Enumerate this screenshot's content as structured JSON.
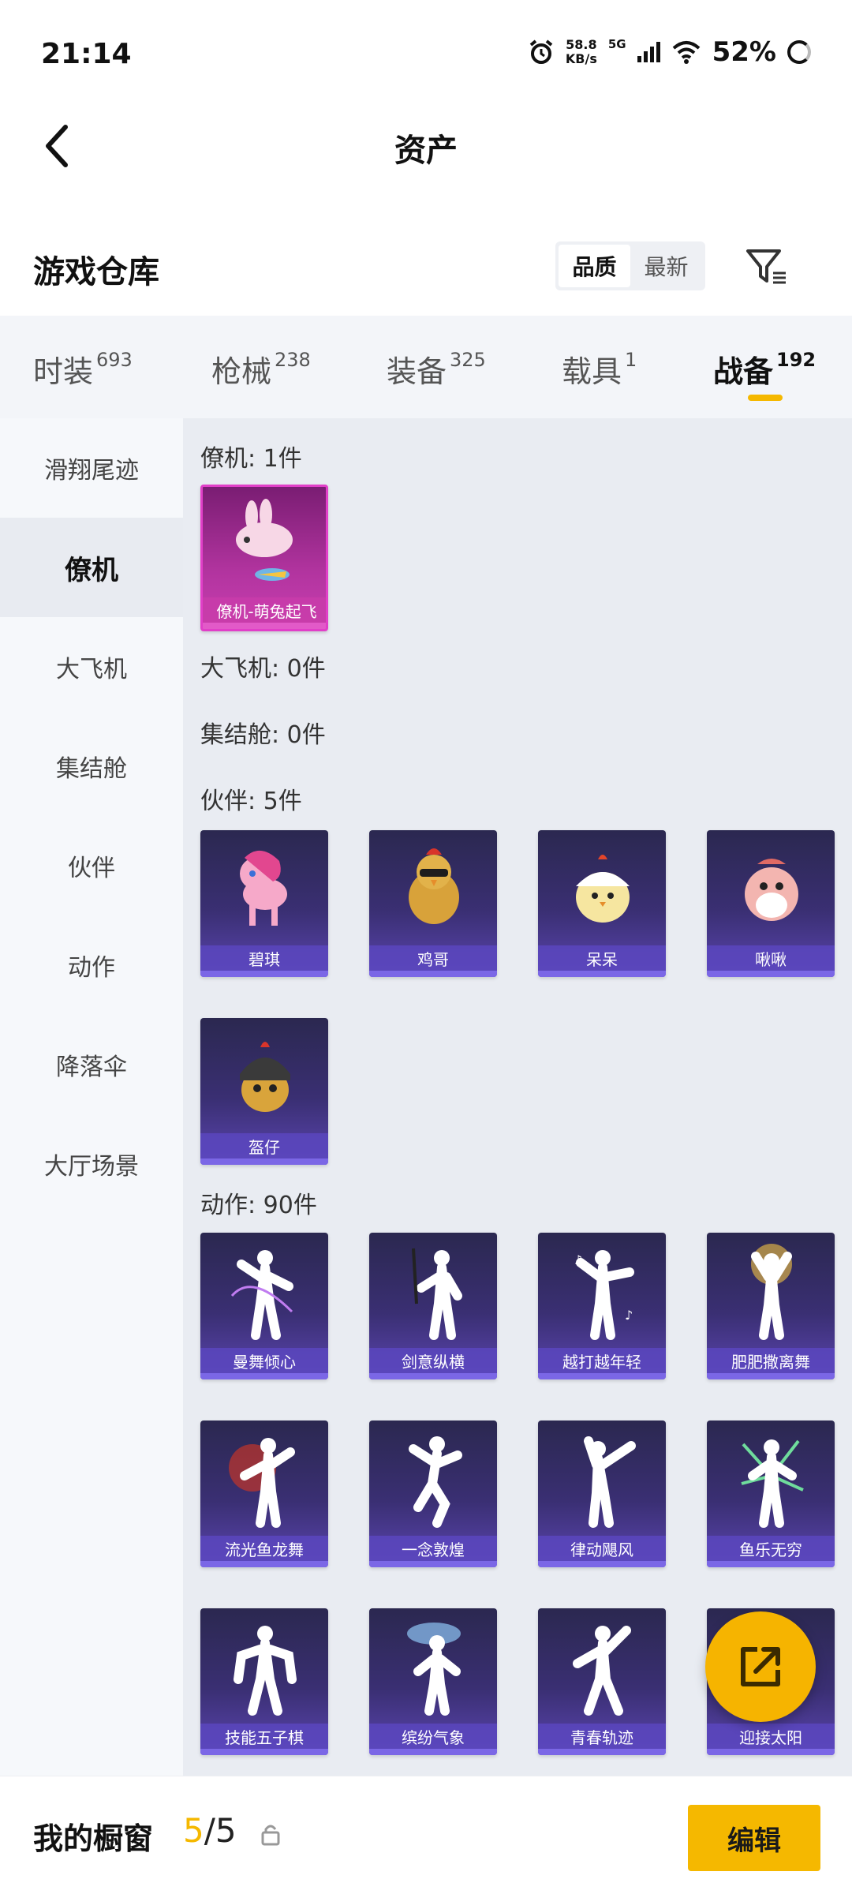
{
  "status_bar": {
    "time": "21:14",
    "speed_value": "58.8",
    "speed_unit": "KB/s",
    "network": "5G",
    "battery": "52%"
  },
  "header": {
    "title": "资产"
  },
  "section": {
    "title": "游戏仓库",
    "sort_quality": "品质",
    "sort_newest": "最新"
  },
  "tabs": [
    {
      "label": "时装",
      "count": "693"
    },
    {
      "label": "枪械",
      "count": "238"
    },
    {
      "label": "装备",
      "count": "325"
    },
    {
      "label": "载具",
      "count": "1"
    },
    {
      "label": "战备",
      "count": "192"
    }
  ],
  "sidebar": [
    {
      "label": "滑翔尾迹"
    },
    {
      "label": "僚机"
    },
    {
      "label": "大飞机"
    },
    {
      "label": "集结舱"
    },
    {
      "label": "伙伴"
    },
    {
      "label": "动作"
    },
    {
      "label": "降落伞"
    },
    {
      "label": "大厅场景"
    }
  ],
  "groups": {
    "wingman": {
      "label": "僚机: 1件",
      "items": [
        "僚机-萌兔起飞"
      ]
    },
    "plane": {
      "label": "大飞机: 0件"
    },
    "capsule": {
      "label": "集结舱: 0件"
    },
    "partner": {
      "label": "伙伴: 5件",
      "items": [
        "碧琪",
        "鸡哥",
        "呆呆",
        "啾啾",
        "盔仔"
      ]
    },
    "emote": {
      "label": "动作: 90件",
      "items": [
        "曼舞倾心",
        "剑意纵横",
        "越打越年轻",
        "肥肥撒离舞",
        "流光鱼龙舞",
        "一念敦煌",
        "律动飓风",
        "鱼乐无穷",
        "技能五子棋",
        "缤纷气象",
        "青春轨迹",
        "迎接太阳"
      ]
    }
  },
  "bottom": {
    "window_label": "我的橱窗",
    "count_current": "5",
    "count_total": "/5",
    "edit_label": "编辑"
  },
  "colors": {
    "accent": "#f5b800",
    "card_purple": "#3a2f73",
    "card_pink": "#b2349f"
  }
}
